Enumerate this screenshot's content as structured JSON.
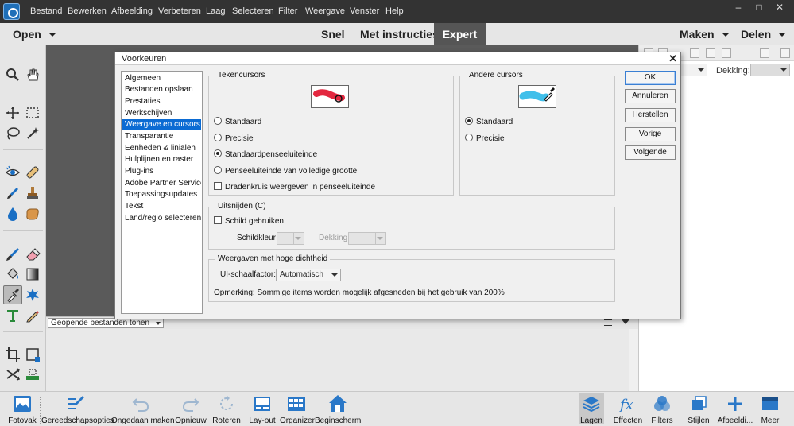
{
  "menubar": {
    "items": [
      "Bestand",
      "Bewerken",
      "Afbeelding",
      "Verbeteren",
      "Laag",
      "Selecteren",
      "Filter",
      "Weergave",
      "Venster",
      "Help"
    ],
    "window_controls": [
      "–",
      "□",
      "✕"
    ]
  },
  "modebar": {
    "open": "Open",
    "snel": "Snel",
    "met_instructies": "Met instructies",
    "expert": "Expert",
    "maken": "Maken",
    "delen": "Delen"
  },
  "right_panel": {
    "dekking_label": "Dekking:"
  },
  "photobin": {
    "select_value": "Geopende bestanden tonen"
  },
  "taskbar": {
    "items": [
      "Fotovak",
      "Gereedschapsopties",
      "Ongedaan maken",
      "Opnieuw",
      "Roteren",
      "Lay-out",
      "Organizer",
      "Beginscherm",
      "Lagen",
      "Effecten",
      "Filters",
      "Stijlen",
      "Afbeeldi...",
      "Meer"
    ]
  },
  "dialog": {
    "title": "Voorkeuren",
    "close": "✕",
    "categories": [
      "Algemeen",
      "Bestanden opslaan",
      "Prestaties",
      "Werkschijven",
      "Weergave en cursors",
      "Transparantie",
      "Eenheden & linialen",
      "Hulplijnen en raster",
      "Plug-ins",
      "Adobe Partner Services",
      "Toepassingsupdates",
      "Tekst",
      "Land/regio selecteren"
    ],
    "selected_category": "Weergave en cursors",
    "tekencursors": {
      "title": "Tekencursors",
      "options": [
        "Standaard",
        "Precisie",
        "Standaardpenseeluiteinde",
        "Penseeluiteinde van volledige grootte"
      ],
      "selected": "Standaardpenseeluiteinde",
      "crosshair": "Dradenkruis weergeven in penseeluiteinde",
      "crosshair_checked": false
    },
    "andere_cursors": {
      "title": "Andere cursors",
      "options": [
        "Standaard",
        "Precisie"
      ],
      "selected": "Standaard"
    },
    "uitsnijden": {
      "title": "Uitsnijden (C)",
      "schild": "Schild gebruiken",
      "schild_checked": false,
      "schildkleur": "Schildkleur",
      "dekking": "Dekking:"
    },
    "hoge_dichtheid": {
      "title": "Weergaven met hoge dichtheid",
      "ui_label": "UI-schaalfactor:",
      "ui_value": "Automatisch",
      "note": "Opmerking: Sommige items worden mogelijk afgesneden bij het gebruik van 200%"
    },
    "buttons": {
      "ok": "OK",
      "annuleren": "Annuleren",
      "herstellen": "Herstellen",
      "vorige": "Vorige",
      "volgende": "Volgende"
    }
  },
  "colors": {
    "menubar_bg": "#333333",
    "expert_tab_bg": "#555555",
    "selection_blue": "#0b6bd3",
    "brush_red": "#e0102a",
    "brush_cyan": "#2bb8e8"
  }
}
